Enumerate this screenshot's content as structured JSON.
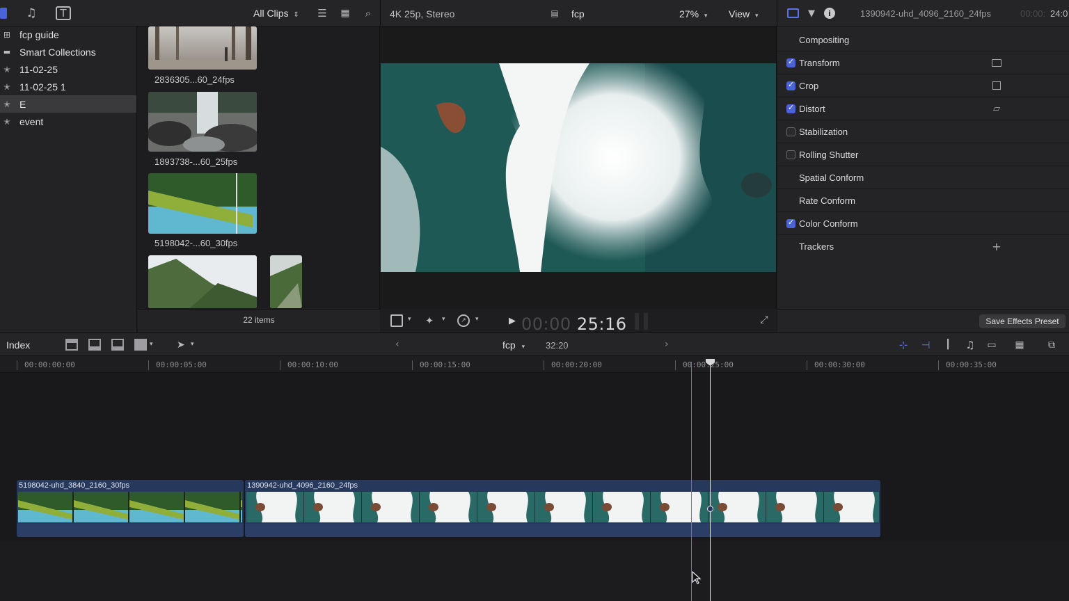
{
  "topbar": {
    "clips_filter": "All Clips",
    "format": "4K 25p, Stereo",
    "project": "fcp",
    "zoom": "27%",
    "view": "View",
    "inspector_title": "1390942-uhd_4096_2160_24fps",
    "inspector_timecode_dim": "00:00:",
    "inspector_timecode": "24:0"
  },
  "sidebar": {
    "items": [
      {
        "label": "fcp guide",
        "icon": "library-icon"
      },
      {
        "label": "Smart Collections",
        "icon": "folder-icon"
      },
      {
        "label": "11-02-25",
        "icon": "event-star-icon"
      },
      {
        "label": "11-02-25 1",
        "icon": "event-star-icon"
      },
      {
        "label": "E",
        "icon": "event-star-icon",
        "selected": true
      },
      {
        "label": "event",
        "icon": "event-star-icon"
      }
    ]
  },
  "browser": {
    "clips": [
      {
        "label": "2836305...60_24fps"
      },
      {
        "label": "1893738-...60_25fps"
      },
      {
        "label": "5198042-...60_30fps"
      }
    ],
    "items_count": "22 items"
  },
  "viewer": {
    "timecode_dim": "00:00",
    "timecode": "25:16"
  },
  "inspector": {
    "rows": [
      {
        "label": "Compositing",
        "checkbox": null
      },
      {
        "label": "Transform",
        "checkbox": true,
        "icon": "transform-icon"
      },
      {
        "label": "Crop",
        "checkbox": true,
        "icon": "crop-icon"
      },
      {
        "label": "Distort",
        "checkbox": true,
        "icon": "distort-icon"
      },
      {
        "label": "Stabilization",
        "checkbox": false
      },
      {
        "label": "Rolling Shutter",
        "checkbox": false
      },
      {
        "label": "Spatial Conform",
        "checkbox": null
      },
      {
        "label": "Rate Conform",
        "checkbox": null
      },
      {
        "label": "Color Conform",
        "checkbox": true
      },
      {
        "label": "Trackers",
        "checkbox": null,
        "icon": "add-icon"
      }
    ],
    "save_preset": "Save Effects Preset"
  },
  "timeline_toolbar": {
    "index": "Index",
    "project": "fcp",
    "duration": "32:20"
  },
  "ruler": {
    "labels": [
      "00:00:00:00",
      "00:00:05:00",
      "00:00:10:00",
      "00:00:15:00",
      "00:00:20:00",
      "00:00:25:00",
      "00:00:30:00",
      "00:00:35:00"
    ]
  },
  "timeline": {
    "clips": [
      {
        "name": "5198042-uhd_3840_2160_30fps"
      },
      {
        "name": "1390942-uhd_4096_2160_24fps"
      }
    ]
  },
  "colors": {
    "accent": "#4b63d9",
    "clip_blue": "#26385c",
    "skimmer": "#d0563c"
  }
}
